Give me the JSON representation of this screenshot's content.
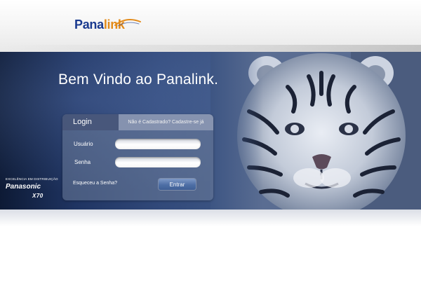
{
  "header": {
    "logo": {
      "part1": "Pana",
      "part2": "link",
      "icon": "swoosh-icon"
    }
  },
  "banner": {
    "welcome": "Bem Vindo ao Panalink.",
    "tiger_image": "white-tiger-photo"
  },
  "login_panel": {
    "tab_login": "Login",
    "tab_register": "Não é Cadastrado? Cadastre-se já",
    "user_label": "Usuário",
    "user_value": "",
    "pass_label": "Senha",
    "pass_value": "",
    "forgot_link": "Esqueceu a Senha?",
    "submit_label": "Entrar"
  },
  "brand": {
    "tagline": "EXCELÊNCIA EM DISTRIBUIÇÃO",
    "name": "Panasonic",
    "model": "X70"
  },
  "colors": {
    "logo_primary": "#1a3a8f",
    "logo_accent": "#e38b1a",
    "banner_dark": "#0d1a35",
    "button": "#4e6fa6"
  }
}
